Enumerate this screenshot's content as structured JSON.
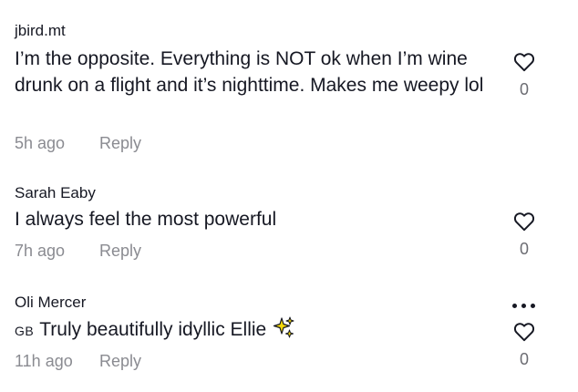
{
  "comments": [
    {
      "username": "jbird.mt",
      "text": "I’m the opposite. Everything is NOT ok when I’m wine drunk on a flight and it’s nighttime. Makes me weepy lol",
      "time": "5h ago",
      "reply_label": "Reply",
      "likes": "0"
    },
    {
      "username": "Sarah Eaby",
      "text": "I always feel the most powerful",
      "time": "7h ago",
      "reply_label": "Reply",
      "likes": "0"
    },
    {
      "username": "Oli Mercer",
      "region": "GB",
      "text": "Truly beautifully idyllic Ellie",
      "emoji_icon": "sparkles-icon",
      "time": "11h ago",
      "reply_label": "Reply",
      "likes": "0"
    }
  ],
  "colors": {
    "text": "#161823",
    "meta": "#8a8b91",
    "sparkle": "#f5d90a"
  }
}
